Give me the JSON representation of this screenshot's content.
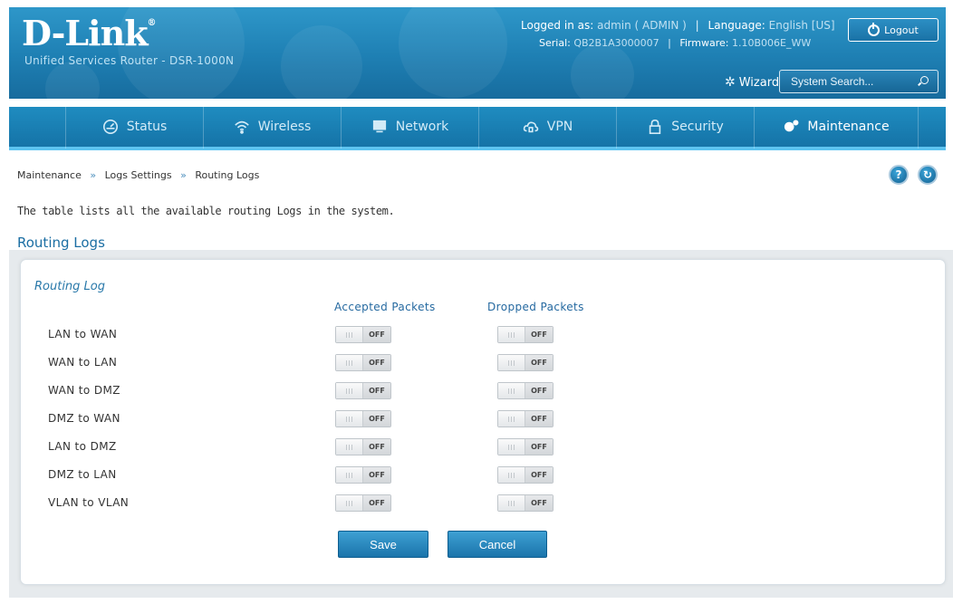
{
  "header": {
    "logo": "D-Link",
    "logo_mark": "®",
    "product": "Unified Services Router - DSR-1000N",
    "logged_in_label": "Logged in as:",
    "logged_in_value": "admin ( ADMIN )",
    "language_label": "Language:",
    "language_value": "English [US]",
    "logout_label": "Logout",
    "serial_label": "Serial:",
    "serial_value": "QB2B1A3000007",
    "firmware_label": "Firmware:",
    "firmware_value": "1.10B006E_WW",
    "wizard_label": "Wizard",
    "search_placeholder": "System Search..."
  },
  "nav": {
    "items": [
      {
        "label": "Status",
        "icon": "dashboard-icon"
      },
      {
        "label": "Wireless",
        "icon": "wifi-icon"
      },
      {
        "label": "Network",
        "icon": "monitor-icon"
      },
      {
        "label": "VPN",
        "icon": "cloud-lock-icon"
      },
      {
        "label": "Security",
        "icon": "lock-icon"
      },
      {
        "label": "Maintenance",
        "icon": "gears-icon",
        "active": true
      }
    ]
  },
  "breadcrumb": [
    "Maintenance",
    "Logs Settings",
    "Routing Logs"
  ],
  "breadcrumb_sep": "»",
  "description": "The table lists all the available routing Logs in the system.",
  "section_title": "Routing Logs",
  "panel": {
    "title": "Routing Log",
    "col_accepted": "Accepted Packets",
    "col_dropped": "Dropped Packets",
    "rows": [
      {
        "label": "LAN to WAN",
        "accepted": "OFF",
        "dropped": "OFF"
      },
      {
        "label": "WAN to LAN",
        "accepted": "OFF",
        "dropped": "OFF"
      },
      {
        "label": "WAN to DMZ",
        "accepted": "OFF",
        "dropped": "OFF"
      },
      {
        "label": "DMZ to WAN",
        "accepted": "OFF",
        "dropped": "OFF"
      },
      {
        "label": "LAN to DMZ",
        "accepted": "OFF",
        "dropped": "OFF"
      },
      {
        "label": "DMZ to LAN",
        "accepted": "OFF",
        "dropped": "OFF"
      },
      {
        "label": "VLAN to VLAN",
        "accepted": "OFF",
        "dropped": "OFF"
      }
    ],
    "save_label": "Save",
    "cancel_label": "Cancel"
  },
  "colors": {
    "header_blue": "#1e7fb3",
    "nav_accent": "#5cc3f0",
    "title_blue": "#1b6ea3",
    "button_blue": "#2a88bf"
  }
}
